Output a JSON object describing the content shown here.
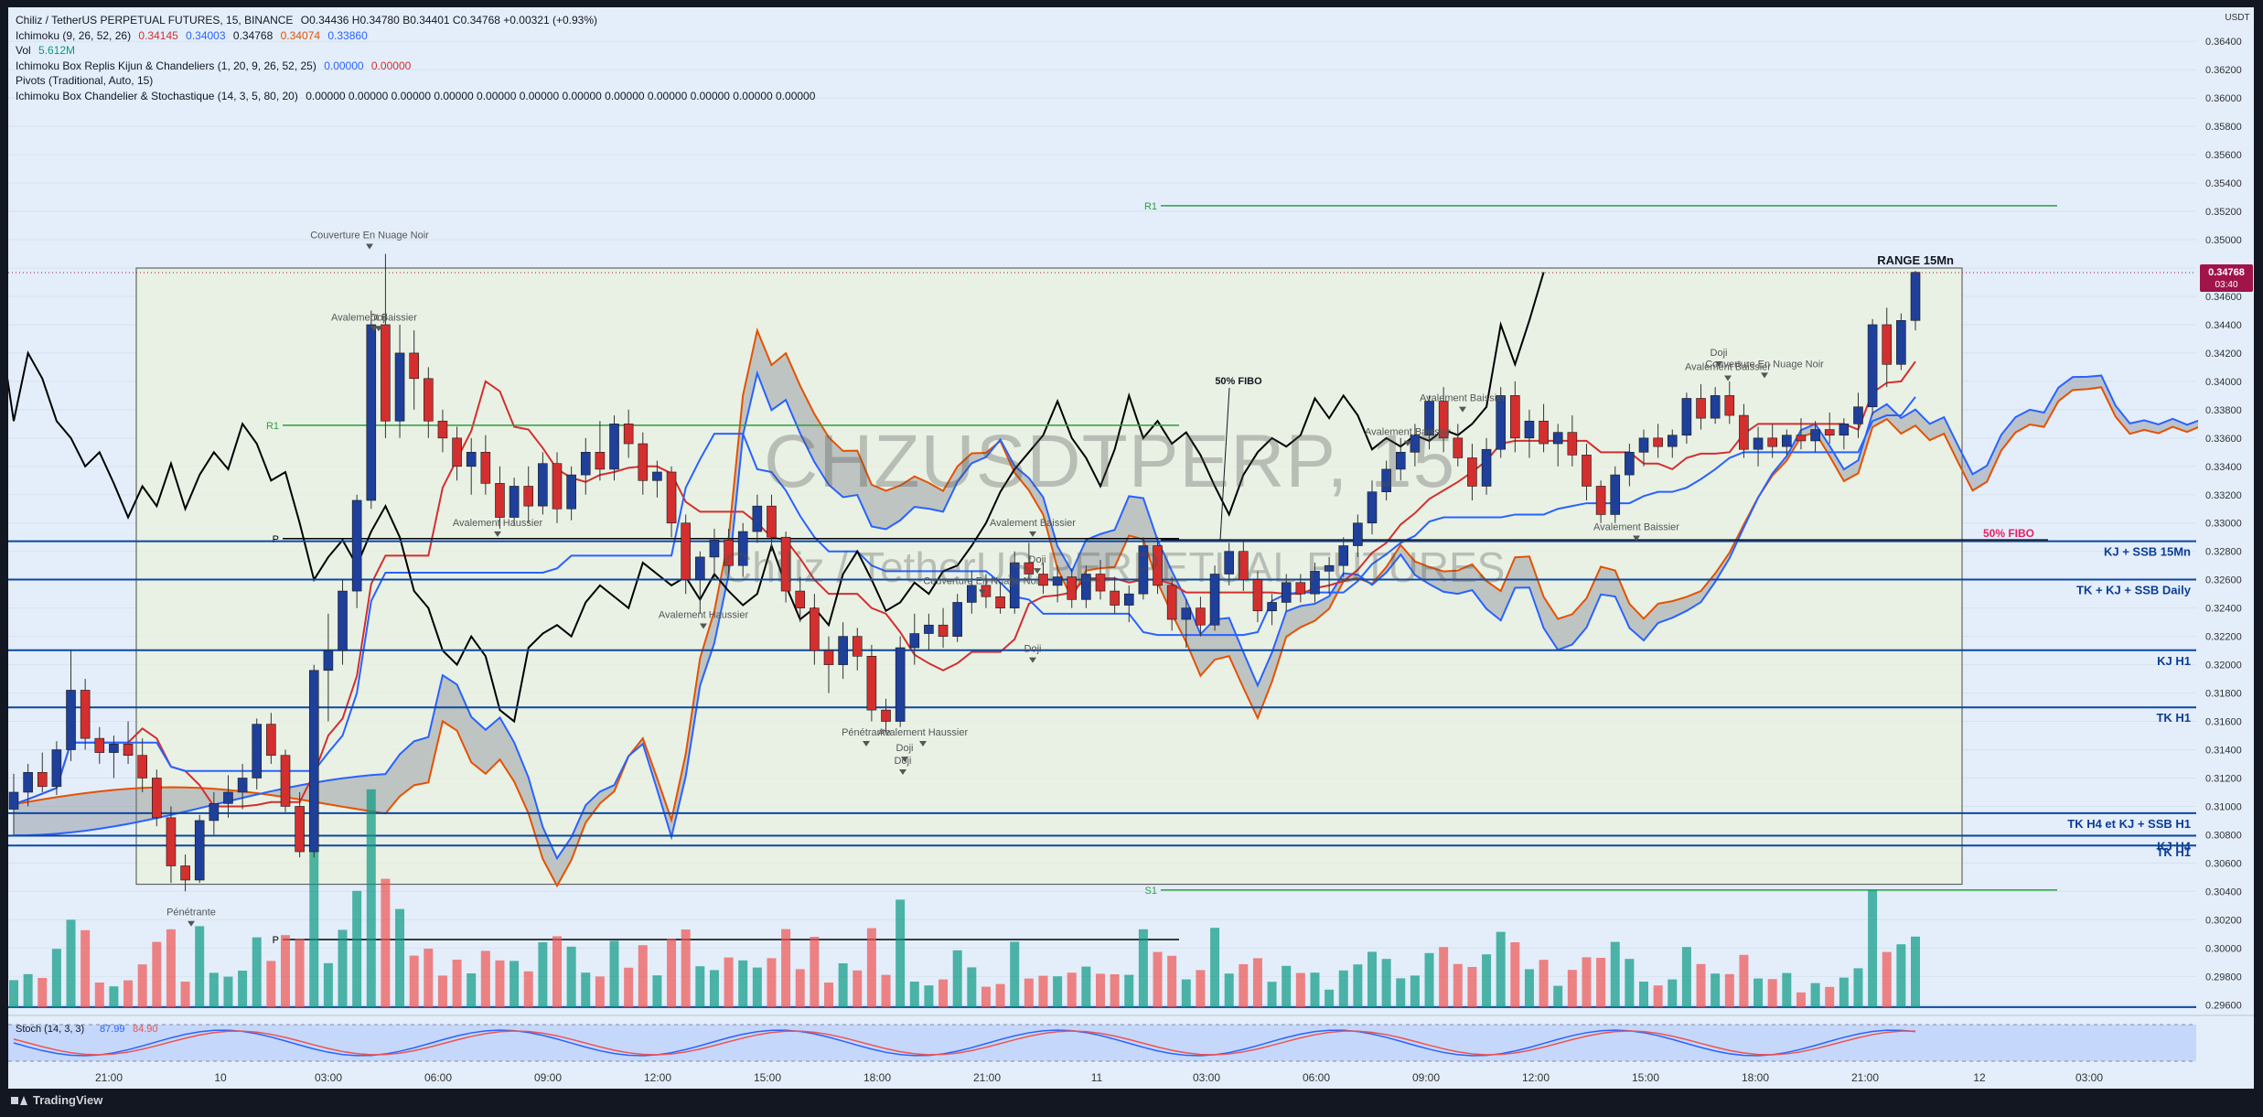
{
  "header": {
    "title": "Chiliz / TetherUS PERPETUAL FUTURES, 15, BINANCE",
    "ohlc": "O0.34436  H0.34780  B0.34401  C0.34768  +0.00321 (+0.93%)",
    "indicators": [
      {
        "name": "Ichimoku (9, 26, 52, 26)",
        "values": [
          "0.34145",
          "0.34003",
          "0.34768",
          "0.34074",
          "0.33860"
        ]
      },
      {
        "name": "Vol",
        "values": [
          "5.612M"
        ]
      },
      {
        "name": "Ichimoku Box Replis Kijun & Chandeliers (1, 20, 9, 26, 52, 25)",
        "values": [
          "0.00000",
          "0.00000"
        ]
      },
      {
        "name": "Pivots (Traditional, Auto, 15)",
        "values": []
      },
      {
        "name": "Ichimoku Box Chandelier & Stochastique (14, 3, 5, 80, 20)",
        "values": [
          "0.00000 0.00000 0.00000 0.00000 0.00000 0.00000 0.00000 0.00000 0.00000 0.00000 0.00000 0.00000"
        ]
      }
    ]
  },
  "watermark": {
    "symbol": "CHZUSDTPERP, 15",
    "description": "Chiliz / TetherUS PERPETUAL FUTURES"
  },
  "branding": {
    "logo_text": "TradingView"
  },
  "colors": {
    "background": "#e3eefa",
    "bull": "#1e3f9a",
    "bear": "#d32f2f",
    "tenkan": "#d32f2f",
    "kijun": "#2962ff",
    "lagging": "#000000",
    "span_a": "#e65100",
    "span_b": "#2962ff",
    "accent_level": "#0d47a1",
    "price_tag": "#a0144a",
    "hot": "#e91e63"
  },
  "chart_data": {
    "type": "candlestick",
    "symbol": "CHZUSDTPERP",
    "timeframe": "15",
    "exchange": "BINANCE",
    "y_axis": {
      "ticks": [
        "0.36400",
        "0.36200",
        "0.36000",
        "0.35800",
        "0.35600",
        "0.35400",
        "0.35200",
        "0.35000",
        "0.34800",
        "0.34600",
        "0.34400",
        "0.34200",
        "0.34000",
        "0.33800",
        "0.33600",
        "0.33400",
        "0.33200",
        "0.33000",
        "0.32800",
        "0.32600",
        "0.32400",
        "0.32200",
        "0.32000",
        "0.31800",
        "0.31600",
        "0.31400",
        "0.31200",
        "0.31000",
        "0.30800",
        "0.30600",
        "0.30400",
        "0.30200",
        "0.30000",
        "0.29800",
        "0.29600"
      ],
      "unit": "USDT",
      "range": [
        0.2955,
        0.3655
      ]
    },
    "x_axis": {
      "ticks": [
        "21:00",
        "10",
        "03:00",
        "06:00",
        "09:00",
        "12:00",
        "15:00",
        "18:00",
        "21:00",
        "11",
        "03:00",
        "06:00",
        "09:00",
        "12:00",
        "15:00",
        "18:00",
        "21:00",
        "12",
        "03:00"
      ]
    },
    "current_price": {
      "value": "0.34768",
      "countdown": "03:40"
    },
    "horizontal_levels": [
      {
        "label": "KJ + SSB 15Mn",
        "price": "0.32872"
      },
      {
        "label": "TK + KJ + SSB Daily",
        "price": "0.32601"
      },
      {
        "label": "KJ H1",
        "price": "0.32102"
      },
      {
        "label": "TK H1",
        "price": "0.31699"
      },
      {
        "label": "TK H4 et  KJ + SSB H1",
        "price": "0.30952"
      },
      {
        "label": "KJ H4",
        "price": "0.30793"
      },
      {
        "label": "TK H1",
        "price": "0.30724"
      },
      {
        "label": "",
        "price": "0.29583"
      }
    ],
    "pivots": [
      {
        "label": "R1",
        "price": 0.3524
      },
      {
        "label": "R1",
        "price": 0.3369
      },
      {
        "label": "P",
        "price": 0.3289
      },
      {
        "label": "S1",
        "price": 0.3041
      },
      {
        "label": "P",
        "price": 0.3006
      }
    ],
    "box": {
      "label": "RANGE 15Mn",
      "top": 0.348,
      "bottom": 0.3045
    },
    "fibo_labels": [
      {
        "label": "50% FIBO",
        "price": 0.3398
      },
      {
        "label": "50% FIBO",
        "price": 0.3292
      }
    ],
    "pattern_labels": [
      {
        "text": "Couverture En Nuage Noir",
        "price": 0.3501
      },
      {
        "text": "Avalement Baissier",
        "price": 0.3443
      },
      {
        "text": "Doji",
        "price": 0.3443
      },
      {
        "text": "Avalement Haussier",
        "price": 0.3298
      },
      {
        "text": "Avalement Haussier",
        "price": 0.3233
      },
      {
        "text": "Avalement Baissier",
        "price": 0.3298
      },
      {
        "text": "Doji",
        "price": 0.3272
      },
      {
        "text": "Couverture En Nuage Noir",
        "price": 0.3257
      },
      {
        "text": "Pénétrante",
        "price": 0.315
      },
      {
        "text": "Avalement Haussier",
        "price": 0.315
      },
      {
        "text": "Doji",
        "price": 0.3139
      },
      {
        "text": "Doji",
        "price": 0.313
      },
      {
        "text": "Doji",
        "price": 0.3209
      },
      {
        "text": "Pénétrante",
        "price": 0.3023
      },
      {
        "text": "Avalement Baissier",
        "price": 0.3386
      },
      {
        "text": "Avalement Baissier",
        "price": 0.3362
      },
      {
        "text": "Doji",
        "price": 0.3418
      },
      {
        "text": "Couverture En Nuage Noir",
        "price": 0.341
      },
      {
        "text": "Avalement Baissier",
        "price": 0.3408
      },
      {
        "text": "Avalement Baissier",
        "price": 0.3295
      }
    ],
    "candles": [
      {
        "o": 0.3098,
        "h": 0.3123,
        "l": 0.308,
        "c": 0.311
      },
      {
        "o": 0.311,
        "h": 0.313,
        "l": 0.31,
        "c": 0.3124
      },
      {
        "o": 0.3124,
        "h": 0.3138,
        "l": 0.311,
        "c": 0.3114
      },
      {
        "o": 0.3114,
        "h": 0.3146,
        "l": 0.3108,
        "c": 0.314
      },
      {
        "o": 0.314,
        "h": 0.321,
        "l": 0.3132,
        "c": 0.3182
      },
      {
        "o": 0.3182,
        "h": 0.319,
        "l": 0.314,
        "c": 0.3148
      },
      {
        "o": 0.3148,
        "h": 0.3156,
        "l": 0.313,
        "c": 0.3138
      },
      {
        "o": 0.3138,
        "h": 0.315,
        "l": 0.312,
        "c": 0.3144
      },
      {
        "o": 0.3144,
        "h": 0.316,
        "l": 0.313,
        "c": 0.3136
      },
      {
        "o": 0.3136,
        "h": 0.3148,
        "l": 0.311,
        "c": 0.312
      },
      {
        "o": 0.312,
        "h": 0.3126,
        "l": 0.3086,
        "c": 0.3092
      },
      {
        "o": 0.3092,
        "h": 0.31,
        "l": 0.3046,
        "c": 0.3058
      },
      {
        "o": 0.3058,
        "h": 0.3066,
        "l": 0.304,
        "c": 0.3048
      },
      {
        "o": 0.3048,
        "h": 0.3094,
        "l": 0.3046,
        "c": 0.309
      },
      {
        "o": 0.309,
        "h": 0.311,
        "l": 0.308,
        "c": 0.3102
      },
      {
        "o": 0.3102,
        "h": 0.3122,
        "l": 0.3092,
        "c": 0.311
      },
      {
        "o": 0.311,
        "h": 0.313,
        "l": 0.3098,
        "c": 0.312
      },
      {
        "o": 0.312,
        "h": 0.3162,
        "l": 0.3112,
        "c": 0.3158
      },
      {
        "o": 0.3158,
        "h": 0.3166,
        "l": 0.313,
        "c": 0.3136
      },
      {
        "o": 0.3136,
        "h": 0.314,
        "l": 0.3096,
        "c": 0.31
      },
      {
        "o": 0.31,
        "h": 0.311,
        "l": 0.3064,
        "c": 0.3068
      },
      {
        "o": 0.3068,
        "h": 0.32,
        "l": 0.3064,
        "c": 0.3196
      },
      {
        "o": 0.3196,
        "h": 0.3236,
        "l": 0.316,
        "c": 0.321
      },
      {
        "o": 0.321,
        "h": 0.326,
        "l": 0.32,
        "c": 0.3252
      },
      {
        "o": 0.3252,
        "h": 0.332,
        "l": 0.324,
        "c": 0.3316
      },
      {
        "o": 0.3316,
        "h": 0.345,
        "l": 0.331,
        "c": 0.344
      },
      {
        "o": 0.344,
        "h": 0.349,
        "l": 0.336,
        "c": 0.3372
      },
      {
        "o": 0.3372,
        "h": 0.344,
        "l": 0.336,
        "c": 0.342
      },
      {
        "o": 0.342,
        "h": 0.3436,
        "l": 0.338,
        "c": 0.3402
      },
      {
        "o": 0.3402,
        "h": 0.341,
        "l": 0.336,
        "c": 0.3372
      },
      {
        "o": 0.3372,
        "h": 0.338,
        "l": 0.335,
        "c": 0.336
      },
      {
        "o": 0.336,
        "h": 0.3368,
        "l": 0.333,
        "c": 0.334
      },
      {
        "o": 0.334,
        "h": 0.336,
        "l": 0.332,
        "c": 0.335
      },
      {
        "o": 0.335,
        "h": 0.3362,
        "l": 0.332,
        "c": 0.3328
      },
      {
        "o": 0.3328,
        "h": 0.334,
        "l": 0.3296,
        "c": 0.3304
      },
      {
        "o": 0.3304,
        "h": 0.3332,
        "l": 0.3298,
        "c": 0.3326
      },
      {
        "o": 0.3326,
        "h": 0.334,
        "l": 0.33,
        "c": 0.3312
      },
      {
        "o": 0.3312,
        "h": 0.335,
        "l": 0.3306,
        "c": 0.3342
      },
      {
        "o": 0.3342,
        "h": 0.335,
        "l": 0.33,
        "c": 0.331
      },
      {
        "o": 0.331,
        "h": 0.334,
        "l": 0.3302,
        "c": 0.3334
      },
      {
        "o": 0.3334,
        "h": 0.336,
        "l": 0.332,
        "c": 0.335
      },
      {
        "o": 0.335,
        "h": 0.3372,
        "l": 0.333,
        "c": 0.3338
      },
      {
        "o": 0.3338,
        "h": 0.3376,
        "l": 0.333,
        "c": 0.337
      },
      {
        "o": 0.337,
        "h": 0.338,
        "l": 0.3346,
        "c": 0.3356
      },
      {
        "o": 0.3356,
        "h": 0.3364,
        "l": 0.332,
        "c": 0.333
      },
      {
        "o": 0.333,
        "h": 0.3344,
        "l": 0.3318,
        "c": 0.3336
      },
      {
        "o": 0.3336,
        "h": 0.334,
        "l": 0.329,
        "c": 0.33
      },
      {
        "o": 0.33,
        "h": 0.3306,
        "l": 0.325,
        "c": 0.326
      },
      {
        "o": 0.326,
        "h": 0.328,
        "l": 0.3236,
        "c": 0.3276
      },
      {
        "o": 0.3276,
        "h": 0.3296,
        "l": 0.326,
        "c": 0.3288
      },
      {
        "o": 0.3288,
        "h": 0.3296,
        "l": 0.3264,
        "c": 0.327
      },
      {
        "o": 0.327,
        "h": 0.33,
        "l": 0.3262,
        "c": 0.3294
      },
      {
        "o": 0.3294,
        "h": 0.332,
        "l": 0.3286,
        "c": 0.3312
      },
      {
        "o": 0.3312,
        "h": 0.332,
        "l": 0.328,
        "c": 0.329
      },
      {
        "o": 0.329,
        "h": 0.3294,
        "l": 0.3244,
        "c": 0.3252
      },
      {
        "o": 0.3252,
        "h": 0.3262,
        "l": 0.323,
        "c": 0.324
      },
      {
        "o": 0.324,
        "h": 0.325,
        "l": 0.32,
        "c": 0.321
      },
      {
        "o": 0.321,
        "h": 0.322,
        "l": 0.318,
        "c": 0.32
      },
      {
        "o": 0.32,
        "h": 0.323,
        "l": 0.319,
        "c": 0.322
      },
      {
        "o": 0.322,
        "h": 0.3226,
        "l": 0.3196,
        "c": 0.3206
      },
      {
        "o": 0.3206,
        "h": 0.3214,
        "l": 0.316,
        "c": 0.3168
      },
      {
        "o": 0.3168,
        "h": 0.3176,
        "l": 0.3152,
        "c": 0.316
      },
      {
        "o": 0.316,
        "h": 0.322,
        "l": 0.3156,
        "c": 0.3212
      },
      {
        "o": 0.3212,
        "h": 0.3236,
        "l": 0.32,
        "c": 0.3222
      },
      {
        "o": 0.3222,
        "h": 0.3236,
        "l": 0.321,
        "c": 0.3228
      },
      {
        "o": 0.3228,
        "h": 0.324,
        "l": 0.3212,
        "c": 0.322
      },
      {
        "o": 0.322,
        "h": 0.325,
        "l": 0.3216,
        "c": 0.3244
      },
      {
        "o": 0.3244,
        "h": 0.3266,
        "l": 0.3236,
        "c": 0.3256
      },
      {
        "o": 0.3256,
        "h": 0.3264,
        "l": 0.324,
        "c": 0.3248
      },
      {
        "o": 0.3248,
        "h": 0.3258,
        "l": 0.3236,
        "c": 0.324
      },
      {
        "o": 0.324,
        "h": 0.328,
        "l": 0.3236,
        "c": 0.3272
      },
      {
        "o": 0.3272,
        "h": 0.3286,
        "l": 0.326,
        "c": 0.3264
      },
      {
        "o": 0.3264,
        "h": 0.3272,
        "l": 0.325,
        "c": 0.3256
      },
      {
        "o": 0.3256,
        "h": 0.327,
        "l": 0.3244,
        "c": 0.3262
      },
      {
        "o": 0.3262,
        "h": 0.3268,
        "l": 0.324,
        "c": 0.3246
      },
      {
        "o": 0.3246,
        "h": 0.327,
        "l": 0.324,
        "c": 0.3264
      },
      {
        "o": 0.3264,
        "h": 0.3274,
        "l": 0.3246,
        "c": 0.3252
      },
      {
        "o": 0.3252,
        "h": 0.3262,
        "l": 0.3236,
        "c": 0.3242
      },
      {
        "o": 0.3242,
        "h": 0.3256,
        "l": 0.323,
        "c": 0.325
      },
      {
        "o": 0.325,
        "h": 0.329,
        "l": 0.3246,
        "c": 0.3284
      },
      {
        "o": 0.3284,
        "h": 0.329,
        "l": 0.325,
        "c": 0.3256
      },
      {
        "o": 0.3256,
        "h": 0.3262,
        "l": 0.3224,
        "c": 0.3232
      },
      {
        "o": 0.3232,
        "h": 0.3246,
        "l": 0.3212,
        "c": 0.324
      },
      {
        "o": 0.324,
        "h": 0.3248,
        "l": 0.322,
        "c": 0.3228
      },
      {
        "o": 0.3228,
        "h": 0.327,
        "l": 0.3224,
        "c": 0.3264
      },
      {
        "o": 0.3264,
        "h": 0.3286,
        "l": 0.3256,
        "c": 0.328
      },
      {
        "o": 0.328,
        "h": 0.3288,
        "l": 0.3252,
        "c": 0.326
      },
      {
        "o": 0.326,
        "h": 0.3266,
        "l": 0.323,
        "c": 0.3238
      },
      {
        "o": 0.3238,
        "h": 0.325,
        "l": 0.3228,
        "c": 0.3244
      },
      {
        "o": 0.3244,
        "h": 0.3264,
        "l": 0.3238,
        "c": 0.3258
      },
      {
        "o": 0.3258,
        "h": 0.3264,
        "l": 0.3244,
        "c": 0.325
      },
      {
        "o": 0.325,
        "h": 0.3272,
        "l": 0.3244,
        "c": 0.3266
      },
      {
        "o": 0.3266,
        "h": 0.3276,
        "l": 0.325,
        "c": 0.327
      },
      {
        "o": 0.327,
        "h": 0.329,
        "l": 0.3262,
        "c": 0.3284
      },
      {
        "o": 0.3284,
        "h": 0.3306,
        "l": 0.3276,
        "c": 0.33
      },
      {
        "o": 0.33,
        "h": 0.333,
        "l": 0.3292,
        "c": 0.3322
      },
      {
        "o": 0.3322,
        "h": 0.3344,
        "l": 0.3316,
        "c": 0.3338
      },
      {
        "o": 0.3338,
        "h": 0.336,
        "l": 0.333,
        "c": 0.335
      },
      {
        "o": 0.335,
        "h": 0.337,
        "l": 0.334,
        "c": 0.3362
      },
      {
        "o": 0.3362,
        "h": 0.339,
        "l": 0.3352,
        "c": 0.3386
      },
      {
        "o": 0.3386,
        "h": 0.3396,
        "l": 0.335,
        "c": 0.336
      },
      {
        "o": 0.336,
        "h": 0.337,
        "l": 0.334,
        "c": 0.3346
      },
      {
        "o": 0.3346,
        "h": 0.3356,
        "l": 0.3316,
        "c": 0.3326
      },
      {
        "o": 0.3326,
        "h": 0.336,
        "l": 0.332,
        "c": 0.3352
      },
      {
        "o": 0.3352,
        "h": 0.3396,
        "l": 0.3346,
        "c": 0.339
      },
      {
        "o": 0.339,
        "h": 0.34,
        "l": 0.335,
        "c": 0.336
      },
      {
        "o": 0.336,
        "h": 0.338,
        "l": 0.3346,
        "c": 0.3372
      },
      {
        "o": 0.3372,
        "h": 0.3384,
        "l": 0.335,
        "c": 0.3356
      },
      {
        "o": 0.3356,
        "h": 0.337,
        "l": 0.334,
        "c": 0.3364
      },
      {
        "o": 0.3364,
        "h": 0.3376,
        "l": 0.334,
        "c": 0.3348
      },
      {
        "o": 0.3348,
        "h": 0.3356,
        "l": 0.3316,
        "c": 0.3326
      },
      {
        "o": 0.3326,
        "h": 0.333,
        "l": 0.33,
        "c": 0.3306
      },
      {
        "o": 0.3306,
        "h": 0.334,
        "l": 0.33,
        "c": 0.3334
      },
      {
        "o": 0.3334,
        "h": 0.3356,
        "l": 0.3326,
        "c": 0.335
      },
      {
        "o": 0.335,
        "h": 0.3366,
        "l": 0.334,
        "c": 0.336
      },
      {
        "o": 0.336,
        "h": 0.337,
        "l": 0.3346,
        "c": 0.3354
      },
      {
        "o": 0.3354,
        "h": 0.3366,
        "l": 0.3346,
        "c": 0.3362
      },
      {
        "o": 0.3362,
        "h": 0.3392,
        "l": 0.3356,
        "c": 0.3388
      },
      {
        "o": 0.3388,
        "h": 0.3398,
        "l": 0.3366,
        "c": 0.3374
      },
      {
        "o": 0.3374,
        "h": 0.3396,
        "l": 0.337,
        "c": 0.339
      },
      {
        "o": 0.339,
        "h": 0.34,
        "l": 0.337,
        "c": 0.3376
      },
      {
        "o": 0.3376,
        "h": 0.3384,
        "l": 0.3346,
        "c": 0.3352
      },
      {
        "o": 0.3352,
        "h": 0.3368,
        "l": 0.334,
        "c": 0.336
      },
      {
        "o": 0.336,
        "h": 0.337,
        "l": 0.3346,
        "c": 0.3354
      },
      {
        "o": 0.3354,
        "h": 0.3366,
        "l": 0.3348,
        "c": 0.3362
      },
      {
        "o": 0.3362,
        "h": 0.3374,
        "l": 0.3352,
        "c": 0.3358
      },
      {
        "o": 0.3358,
        "h": 0.3372,
        "l": 0.335,
        "c": 0.3366
      },
      {
        "o": 0.3366,
        "h": 0.3378,
        "l": 0.3356,
        "c": 0.3362
      },
      {
        "o": 0.3362,
        "h": 0.3374,
        "l": 0.3352,
        "c": 0.337
      },
      {
        "o": 0.337,
        "h": 0.3392,
        "l": 0.336,
        "c": 0.3382
      },
      {
        "o": 0.3382,
        "h": 0.3444,
        "l": 0.3376,
        "c": 0.344
      },
      {
        "o": 0.344,
        "h": 0.3452,
        "l": 0.3396,
        "c": 0.3412
      },
      {
        "o": 0.3412,
        "h": 0.3448,
        "l": 0.3408,
        "c": 0.3443
      },
      {
        "o": 0.3443,
        "h": 0.3478,
        "l": 0.3436,
        "c": 0.3477
      }
    ],
    "volume_unit": "relative",
    "stoch": {
      "label": "Stoch (14, 3, 3)",
      "k": "87.99",
      "d": "84.90"
    }
  }
}
